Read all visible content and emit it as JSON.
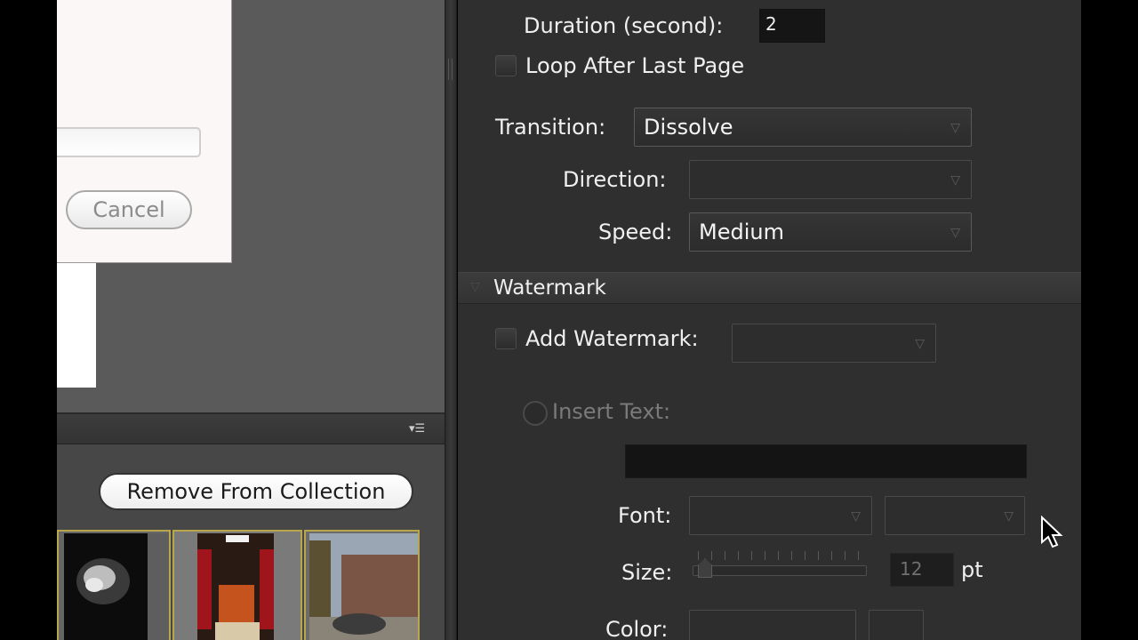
{
  "dialog": {
    "cancel_label": "Cancel"
  },
  "collection": {
    "remove_label": "Remove From Collection",
    "menu_icon": "panel-menu-icon"
  },
  "slideshow": {
    "duration_label": "Duration (second):",
    "duration_value": "2",
    "loop_label": "Loop After Last Page",
    "transition_label": "Transition:",
    "transition_value": "Dissolve",
    "direction_label": "Direction:",
    "direction_value": "",
    "speed_label": "Speed:",
    "speed_value": "Medium"
  },
  "watermark": {
    "section_label": "Watermark",
    "add_label": "Add Watermark:",
    "add_value": "",
    "insert_text_label": "Insert Text:",
    "font_label": "Font:",
    "size_label": "Size:",
    "size_value": "12",
    "size_unit": "pt",
    "color_label": "Color:"
  },
  "colors": {
    "panel_bg": "#2f2f2f",
    "thumb_border": "#b8a64c"
  }
}
